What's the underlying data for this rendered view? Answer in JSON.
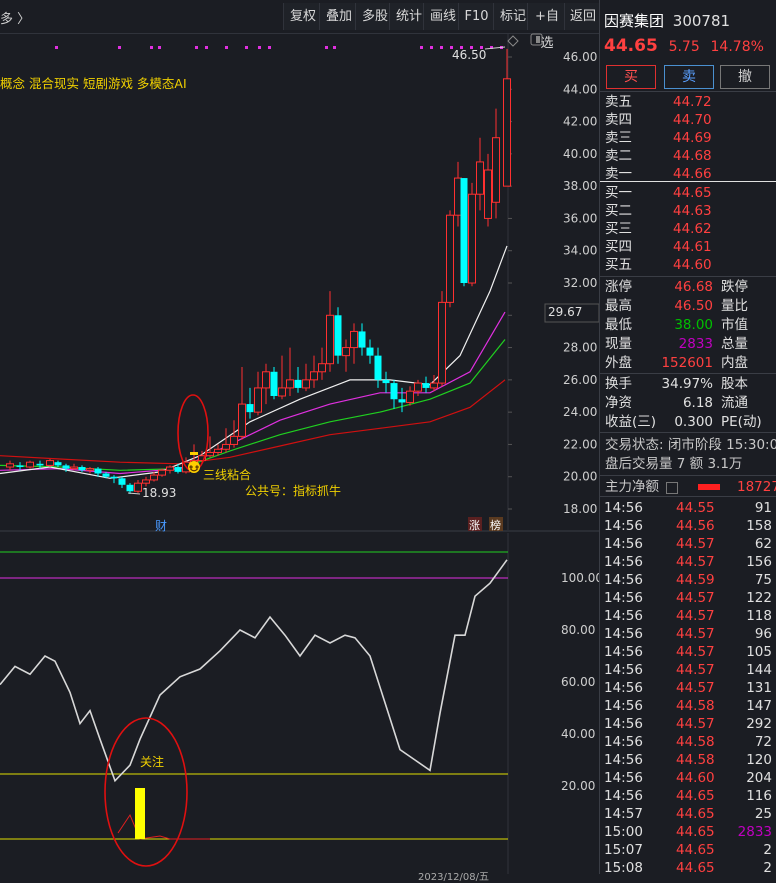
{
  "toolbar": {
    "left_label": "多 〉",
    "buttons": [
      "复权",
      "叠加",
      "多股",
      "统计",
      "画线",
      "F10",
      "标记",
      "+自选",
      "返回"
    ]
  },
  "stock": {
    "name": "因赛集团",
    "code": "300781",
    "price": "44.65",
    "change": "5.75",
    "change_pct": "14.78%"
  },
  "trade_buttons": {
    "buy": "买",
    "sell": "卖",
    "cancel": "撤"
  },
  "order_book": {
    "asks": [
      {
        "label": "卖五",
        "price": "44.72"
      },
      {
        "label": "卖四",
        "price": "44.70"
      },
      {
        "label": "卖三",
        "price": "44.69"
      },
      {
        "label": "卖二",
        "price": "44.68"
      },
      {
        "label": "卖一",
        "price": "44.66"
      }
    ],
    "bids": [
      {
        "label": "买一",
        "price": "44.65"
      },
      {
        "label": "买二",
        "price": "44.63"
      },
      {
        "label": "买三",
        "price": "44.62"
      },
      {
        "label": "买四",
        "price": "44.61"
      },
      {
        "label": "买五",
        "price": "44.60"
      }
    ]
  },
  "quote": {
    "zhangting_label": "涨停",
    "zhangting": "46.68",
    "dieting_label": "跌停",
    "high_label": "最高",
    "high": "46.50",
    "liangbi_label": "量比",
    "low_label": "最低",
    "low": "38.00",
    "shizhi_label": "市值",
    "xianliang_label": "现量",
    "xianliang": "2833",
    "zongliang_label": "总量",
    "waipan_label": "外盘",
    "waipan": "152601",
    "neipan_label": "内盘",
    "huanshou_label": "换手",
    "huanshou": "34.97%",
    "guben_label": "股本",
    "jingzi_label": "净资",
    "jingzi": "6.18",
    "liutong_label": "流通",
    "shouyi_label": "收益(三)",
    "shouyi": "0.300",
    "pe_label": "PE(动)",
    "status": "交易状态: 闭市阶段 15:30:03",
    "after_hours": "盘后交易量 7 额 3.1万",
    "main_flow_label": "主力净额",
    "main_flow_value": "18727"
  },
  "ticks": [
    {
      "t": "14:56",
      "p": "44.55",
      "v": "91"
    },
    {
      "t": "14:56",
      "p": "44.56",
      "v": "158"
    },
    {
      "t": "14:56",
      "p": "44.57",
      "v": "62"
    },
    {
      "t": "14:56",
      "p": "44.57",
      "v": "156"
    },
    {
      "t": "14:56",
      "p": "44.59",
      "v": "75"
    },
    {
      "t": "14:56",
      "p": "44.57",
      "v": "122"
    },
    {
      "t": "14:56",
      "p": "44.57",
      "v": "118"
    },
    {
      "t": "14:56",
      "p": "44.57",
      "v": "96"
    },
    {
      "t": "14:56",
      "p": "44.57",
      "v": "105"
    },
    {
      "t": "14:56",
      "p": "44.57",
      "v": "144"
    },
    {
      "t": "14:56",
      "p": "44.57",
      "v": "131"
    },
    {
      "t": "14:56",
      "p": "44.58",
      "v": "147"
    },
    {
      "t": "14:56",
      "p": "44.57",
      "v": "292"
    },
    {
      "t": "14:56",
      "p": "44.58",
      "v": "72"
    },
    {
      "t": "14:56",
      "p": "44.58",
      "v": "120"
    },
    {
      "t": "14:56",
      "p": "44.60",
      "v": "204"
    },
    {
      "t": "14:56",
      "p": "44.65",
      "v": "116"
    },
    {
      "t": "14:57",
      "p": "44.65",
      "v": "25"
    },
    {
      "t": "15:00",
      "p": "44.65",
      "v": "2833"
    },
    {
      "t": "15:07",
      "p": "44.65",
      "v": "2"
    },
    {
      "t": "15:08",
      "p": "44.65",
      "v": "2"
    }
  ],
  "chart": {
    "concepts": "概念 混合现实 短剧游戏 多模态AI",
    "price_axis": [
      "46.00",
      "44.00",
      "42.00",
      "40.00",
      "38.00",
      "36.00",
      "34.00",
      "32.00",
      "30.00",
      "28.00",
      "26.00",
      "24.00",
      "22.00",
      "20.00",
      "18.00"
    ],
    "current_price_tag": "29.67",
    "high_label": "46.50",
    "low_label": "18.93",
    "annotation_ma": "三线粘合",
    "annotation_wechat": "公共号：指标抓牛",
    "marker_cai": "财",
    "marker_zhang": "涨",
    "marker_bang": "榜",
    "osc_axis": [
      "100.00",
      "80.00",
      "60.00",
      "40.00",
      "20.00"
    ],
    "attention_label": "关注",
    "bottom_date": "2023/12/08/五"
  },
  "colors": {
    "up": "#ff3030",
    "down": "#00ffff",
    "bg": "#1b1d23"
  }
}
